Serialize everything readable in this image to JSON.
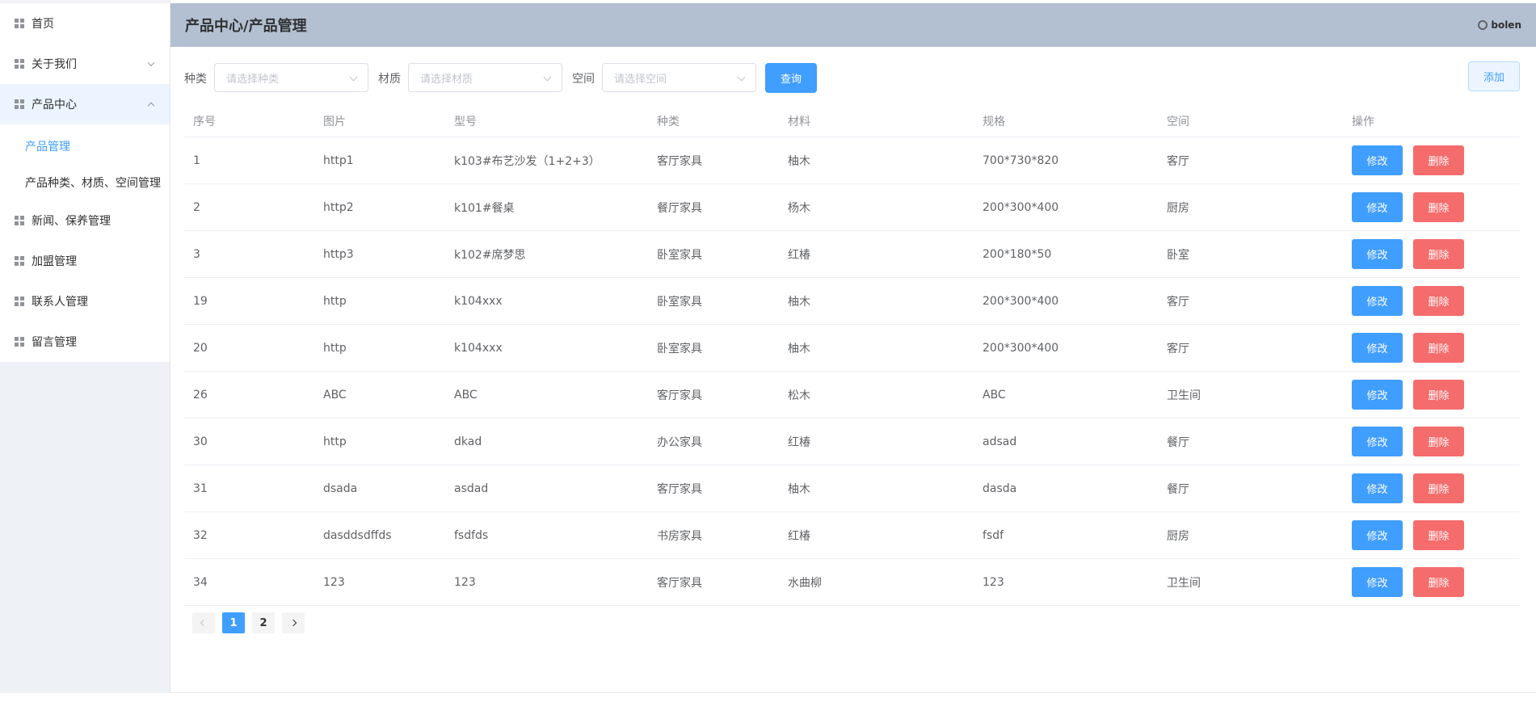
{
  "sidebar": {
    "items": [
      {
        "label": "首页"
      },
      {
        "label": "关于我们"
      },
      {
        "label": "产品中心"
      },
      {
        "label": "新闻、保养管理"
      },
      {
        "label": "加盟管理"
      },
      {
        "label": "联系人管理"
      },
      {
        "label": "留言管理"
      }
    ],
    "submenu": [
      {
        "label": "产品管理"
      },
      {
        "label": "产品种类、材质、空间管理"
      }
    ]
  },
  "header": {
    "title": "产品中心/产品管理",
    "user": "bolen"
  },
  "filters": {
    "category_label": "种类",
    "category_placeholder": "请选择种类",
    "material_label": "材质",
    "material_placeholder": "请选择材质",
    "space_label": "空间",
    "space_placeholder": "请选择空间",
    "query_label": "查询",
    "add_label": "添加"
  },
  "table": {
    "columns": [
      "序号",
      "图片",
      "型号",
      "种类",
      "材料",
      "规格",
      "空间",
      "操作"
    ],
    "edit_label": "修改",
    "delete_label": "删除",
    "rows": [
      [
        "1",
        "http1",
        "k103#布艺沙发（1+2+3）",
        "客厅家具",
        "柚木",
        "700*730*820",
        "客厅"
      ],
      [
        "2",
        "http2",
        "k101#餐桌",
        "餐厅家具",
        "杨木",
        "200*300*400",
        "厨房"
      ],
      [
        "3",
        "http3",
        "k102#席梦思",
        "卧室家具",
        "红椿",
        "200*180*50",
        "卧室"
      ],
      [
        "19",
        "http",
        "k104xxx",
        "卧室家具",
        "柚木",
        "200*300*400",
        "客厅"
      ],
      [
        "20",
        "http",
        "k104xxx",
        "卧室家具",
        "柚木",
        "200*300*400",
        "客厅"
      ],
      [
        "26",
        "ABC",
        "ABC",
        "客厅家具",
        "松木",
        "ABC",
        "卫生间"
      ],
      [
        "30",
        "http",
        "dkad",
        "办公家具",
        "红椿",
        "adsad",
        "餐厅"
      ],
      [
        "31",
        "dsada",
        "asdad",
        "客厅家具",
        "柚木",
        "dasda",
        "餐厅"
      ],
      [
        "32",
        "dasddsdffds",
        "fsdfds",
        "书房家具",
        "红椿",
        "fsdf",
        "厨房"
      ],
      [
        "34",
        "123",
        "123",
        "客厅家具",
        "水曲柳",
        "123",
        "卫生间"
      ]
    ]
  },
  "pagination": {
    "pages": [
      "1",
      "2"
    ],
    "current": "1"
  },
  "colors": {
    "primary": "#409eff",
    "danger": "#f56c6c",
    "header_bg": "#b3c0d1"
  }
}
